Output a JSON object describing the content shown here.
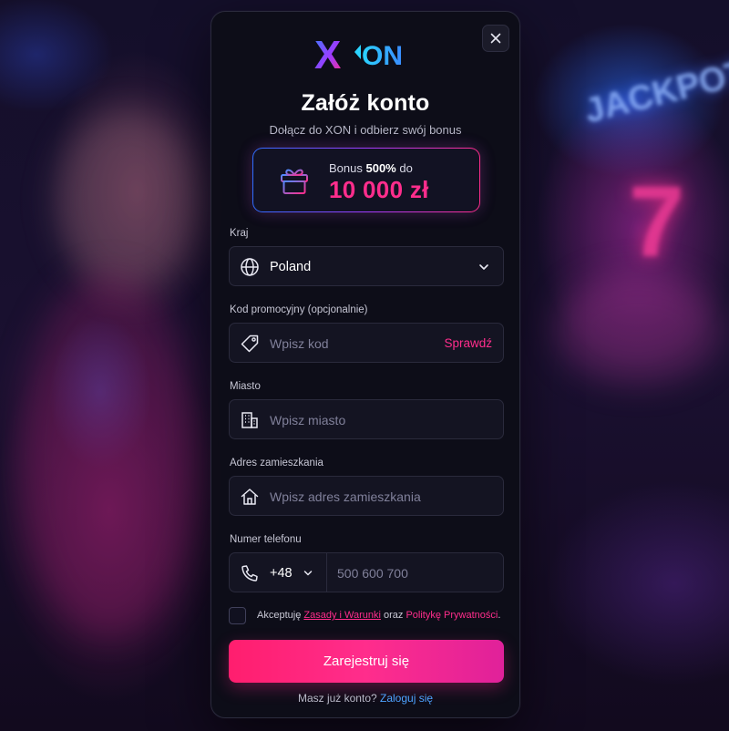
{
  "background": {
    "sign_text": "JACKPOT",
    "slot_symbol": "7"
  },
  "logo": {
    "text_x": "X",
    "text_on": "ON"
  },
  "header": {
    "title": "Załóż konto",
    "subtitle": "Dołącz do XON i odbierz swój bonus"
  },
  "bonus": {
    "prefix": "Bonus ",
    "percent": "500%",
    "suffix": " do",
    "amount": "10 000 zł",
    "icon": "gift-icon"
  },
  "form": {
    "country": {
      "label": "Kraj",
      "value": "Poland",
      "icon": "globe-icon"
    },
    "promo": {
      "label": "Kod promocyjny (opcjonalnie)",
      "placeholder": "Wpisz kod",
      "action": "Sprawdź",
      "icon": "tag-icon"
    },
    "city": {
      "label": "Miasto",
      "placeholder": "Wpisz miasto",
      "icon": "building-icon"
    },
    "address": {
      "label": "Adres zamieszkania",
      "placeholder": "Wpisz adres zamieszkania",
      "icon": "home-icon"
    },
    "phone": {
      "label": "Numer telefonu",
      "dial_code": "+48",
      "placeholder": "500 600 700",
      "icon": "phone-icon"
    },
    "terms": {
      "prefix": "Akceptuję ",
      "link1": "Zasady i Warunki",
      "middle": " oraz ",
      "link2": "Politykę Prywatności",
      "suffix": ".",
      "checked": false
    },
    "submit_label": "Zarejestruj się"
  },
  "footer": {
    "question": "Masz już konto?",
    "login_link": "Zaloguj się"
  },
  "colors": {
    "accent_pink": "#ff2d8c",
    "accent_blue": "#4da3ff",
    "card_bg": "#0d0d18"
  }
}
